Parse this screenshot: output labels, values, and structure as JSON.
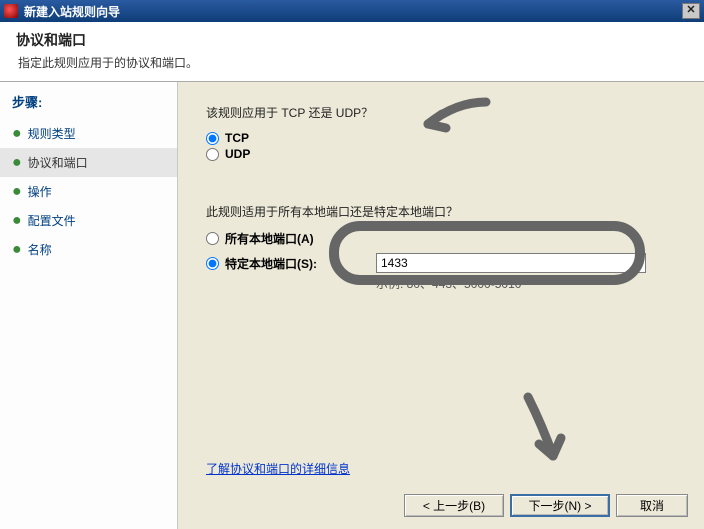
{
  "window": {
    "title": "新建入站规则向导"
  },
  "header": {
    "title": "协议和端口",
    "subtitle": "指定此规则应用于的协议和端口。"
  },
  "sidebar": {
    "steps_label": "步骤:",
    "items": [
      {
        "label": "规则类型"
      },
      {
        "label": "协议和端口"
      },
      {
        "label": "操作"
      },
      {
        "label": "配置文件"
      },
      {
        "label": "名称"
      }
    ]
  },
  "main": {
    "q1": "该规则应用于 TCP 还是 UDP？",
    "radio_tcp": "TCP",
    "radio_udp": "UDP",
    "q2": "此规则适用于所有本地端口还是特定本地端口？",
    "radio_all_ports": "所有本地端口(A)",
    "radio_specific_ports": "特定本地端口(S):",
    "port_value": "1433",
    "port_example": "示例: 80、443、5000-5010",
    "link_more": "了解协议和端口的详细信息"
  },
  "footer": {
    "back": "< 上一步(B)",
    "next": "下一步(N) >",
    "cancel": "取消"
  }
}
